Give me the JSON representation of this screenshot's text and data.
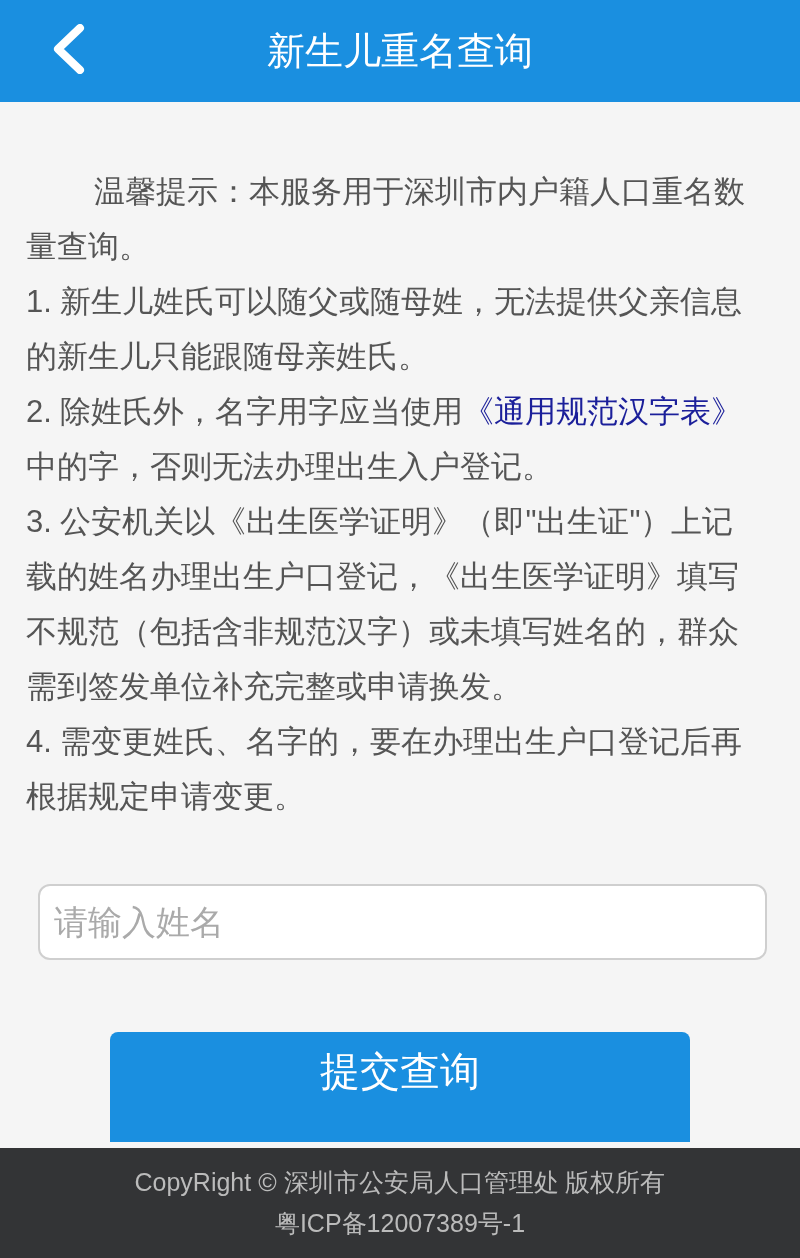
{
  "header": {
    "title": "新生儿重名查询"
  },
  "notice": [
    {
      "kind": "intro",
      "text": "温馨提示：本服务用于深圳市内户籍人口重名数量查询。"
    },
    {
      "kind": "text",
      "text": "1. 新生儿姓氏可以随父或随母姓，无法提供父亲信息的新生儿只能跟随母亲姓氏。"
    },
    {
      "kind": "link",
      "before": "2. 除姓氏外，名字用字应当使用",
      "link": "《通用规范汉字表》",
      "after": "中的字，否则无法办理出生入户登记。"
    },
    {
      "kind": "text",
      "text": "3. 公安机关以《出生医学证明》（即\"出生证\"）上记载的姓名办理出生户口登记，《出生医学证明》填写不规范（包括含非规范汉字）或未填写姓名的，群众需到签发单位补充完整或申请换发。"
    },
    {
      "kind": "text",
      "text": "4. 需变更姓氏、名字的，要在办理出生户口登记后再根据规定申请变更。"
    }
  ],
  "name_field": {
    "placeholder": "请输入姓名"
  },
  "submit_button": "提交查询",
  "footer": [
    "CopyRight © 深圳市公安局人口管理处 版权所有",
    "粤ICP备12007389号-1"
  ]
}
